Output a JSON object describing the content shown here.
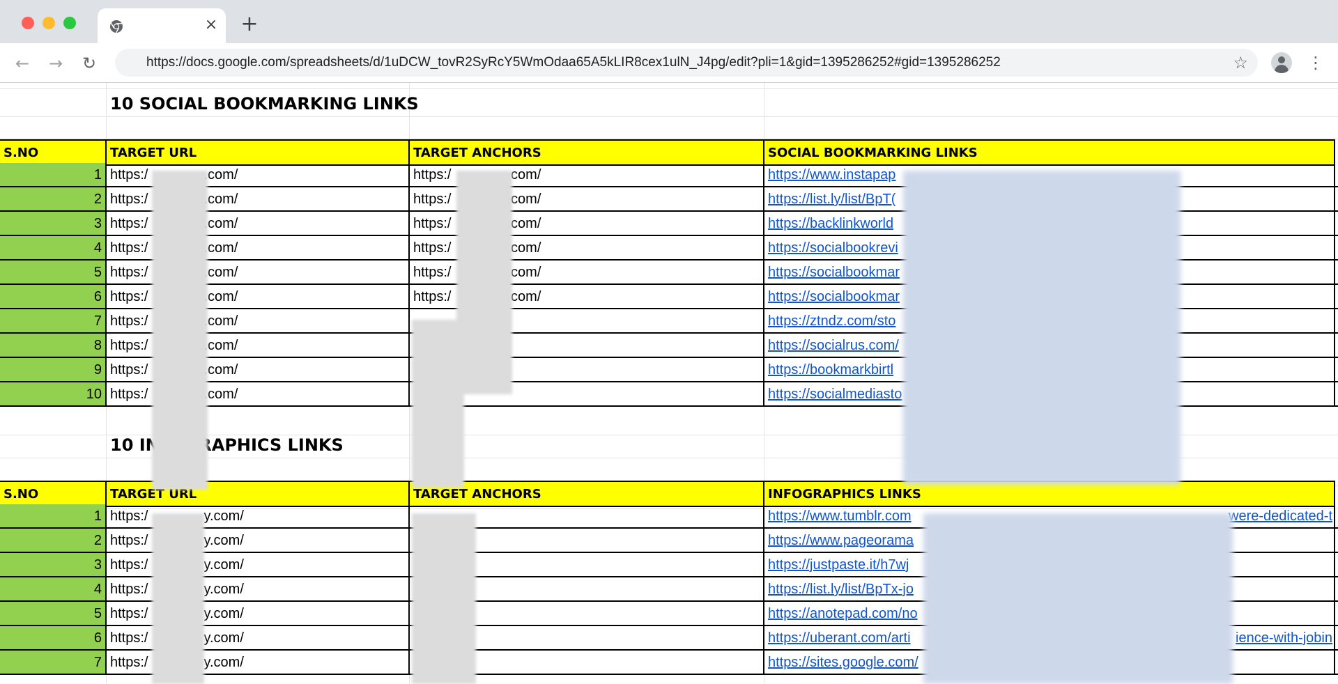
{
  "browser": {
    "url": "https://docs.google.com/spreadsheets/d/1uDCW_tovR2SyRcY5WmOdaa65A5kLIR8cex1ulN_J4pg/edit?pli=1&gid=1395286252#gid=1395286252",
    "tab_close_label": "×",
    "new_tab_label": "+",
    "back_label": "←",
    "forward_label": "→",
    "reload_label": "↻",
    "bookmark_label": "☆",
    "menu_label": "⋮"
  },
  "section1": {
    "title": "10 SOCIAL BOOKMARKING LINKS",
    "headers": [
      "S.NO",
      "TARGET URL",
      "TARGET ANCHORS",
      "SOCIAL BOOKMARKING LINKS"
    ],
    "rows": [
      {
        "num": "1",
        "url_start": "https:/",
        "url_end": ".com/",
        "anchor_start": "https:/",
        "anchor_end": ".com/",
        "link": "https://www.instapap"
      },
      {
        "num": "2",
        "url_start": "https:/",
        "url_end": ".com/",
        "anchor_start": "https:/",
        "anchor_end": ".com/",
        "link": "https://list.ly/list/BpT("
      },
      {
        "num": "3",
        "url_start": "https:/",
        "url_end": ".com/",
        "anchor_start": "https:/",
        "anchor_end": ".com/",
        "link": "https://backlinkworld"
      },
      {
        "num": "4",
        "url_start": "https:/",
        "url_end": ".com/",
        "anchor_start": "https:/",
        "anchor_end": ".com/",
        "link": "https://socialbookrevi"
      },
      {
        "num": "5",
        "url_start": "https:/",
        "url_end": ".com/",
        "anchor_start": "https:/",
        "anchor_end": ".com/",
        "link": "https://socialbookmar"
      },
      {
        "num": "6",
        "url_start": "https:/",
        "url_end": ".com/",
        "anchor_start": "https:/",
        "anchor_end": ".com/",
        "link": "https://socialbookmar"
      },
      {
        "num": "7",
        "url_start": "https:/",
        "url_end": ".com/",
        "anchor_start": "",
        "anchor_end": "",
        "link": "https://ztndz.com/sto"
      },
      {
        "num": "8",
        "url_start": "https:/",
        "url_end": ".com/",
        "anchor_start": "",
        "anchor_end": "",
        "link": "https://socialrus.com/"
      },
      {
        "num": "9",
        "url_start": "https:/",
        "url_end": ".com/",
        "anchor_start": "",
        "anchor_end": "",
        "link": "https://bookmarkbirtl"
      },
      {
        "num": "10",
        "url_start": "https:/",
        "url_end": ".com/",
        "anchor_start": "",
        "anchor_end": "",
        "link": "https://socialmediasto"
      }
    ]
  },
  "section2": {
    "title": "10 INFOGRAPHICS LINKS",
    "headers": [
      "S.NO",
      "TARGET URL",
      "TARGET ANCHORS",
      "INFOGRAPHICS LINKS"
    ],
    "rows": [
      {
        "num": "1",
        "url_start": "https:/",
        "url_end": "y.com/",
        "link": "https://www.tumblr.com",
        "link_tail": "were-dedicated-t"
      },
      {
        "num": "2",
        "url_start": "https:/",
        "url_end": "y.com/",
        "link": "https://www.pageorama",
        "link_tail": ""
      },
      {
        "num": "3",
        "url_start": "https:/",
        "url_end": "y.com/",
        "link": "https://justpaste.it/h7wj",
        "link_tail": ""
      },
      {
        "num": "4",
        "url_start": "https:/",
        "url_end": "y.com/",
        "link": "https://list.ly/list/BpTx-jo",
        "link_tail": ""
      },
      {
        "num": "5",
        "url_start": "https:/",
        "url_end": "y.com/",
        "link": "https://anotepad.com/no",
        "link_tail": ""
      },
      {
        "num": "6",
        "url_start": "https:/",
        "url_end": "y.com/",
        "link": "https://uberant.com/arti",
        "link_tail": "ience-with-jobin"
      },
      {
        "num": "7",
        "url_start": "https:/",
        "url_end": "y.com/",
        "link": "https://sites.google.com/",
        "link_tail": ""
      }
    ]
  }
}
